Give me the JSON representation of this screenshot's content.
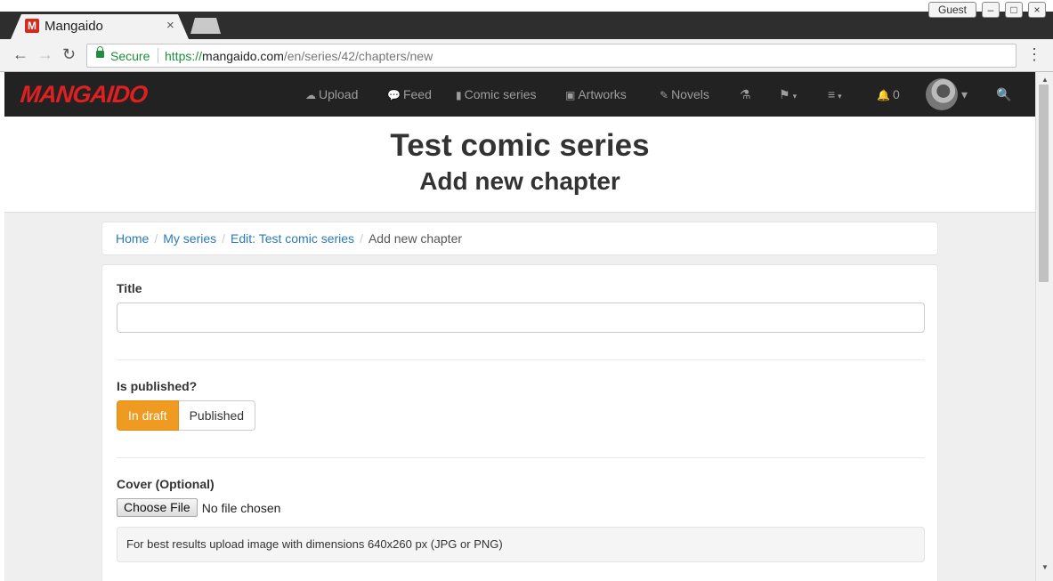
{
  "browser": {
    "tab_title": "Mangaido",
    "tab_favicon": "M",
    "tab_close": "×",
    "guest_label": "Guest",
    "secure_label": "Secure",
    "url_scheme": "https://",
    "url_host": "mangaido.com",
    "url_path": "/en/series/42/chapters/new",
    "back": "←",
    "forward": "→",
    "reload": "↻",
    "menu": "⋮",
    "win_min": "–",
    "win_max": "□",
    "win_close": "×"
  },
  "navbar": {
    "brand": "MANGAIDO",
    "items": [
      {
        "icon": "☁",
        "label": "Upload"
      },
      {
        "icon": "💬",
        "label": "Feed"
      },
      {
        "icon": "▮",
        "label": "Comic series"
      },
      {
        "icon": "▣",
        "label": "Artworks"
      },
      {
        "icon": "✎",
        "label": "Novels"
      }
    ],
    "extra_icons": {
      "potion": "⚗",
      "flag": "⚑",
      "menu": "≡",
      "bell": "🔔",
      "search": "🔍"
    },
    "notification_count": "0",
    "caret": "▾"
  },
  "header": {
    "series_title": "Test comic series",
    "page_title": "Add new chapter"
  },
  "breadcrumb": {
    "items": [
      "Home",
      "My series",
      "Edit: Test comic series"
    ],
    "active": "Add new chapter",
    "divider": "/"
  },
  "form": {
    "title_label": "Title",
    "title_value": "",
    "published_label": "Is published?",
    "draft_option": "In draft",
    "published_option": "Published",
    "selected": "In draft",
    "cover_label": "Cover (Optional)",
    "choose_file": "Choose File",
    "file_status": "No file chosen",
    "cover_help": "For best results upload image with dimensions 640x260 px (JPG or PNG)"
  },
  "colors": {
    "accent": "#ef9a21",
    "brand": "#e02020",
    "link": "#2a7ab8",
    "navbar_bg": "#222222"
  }
}
